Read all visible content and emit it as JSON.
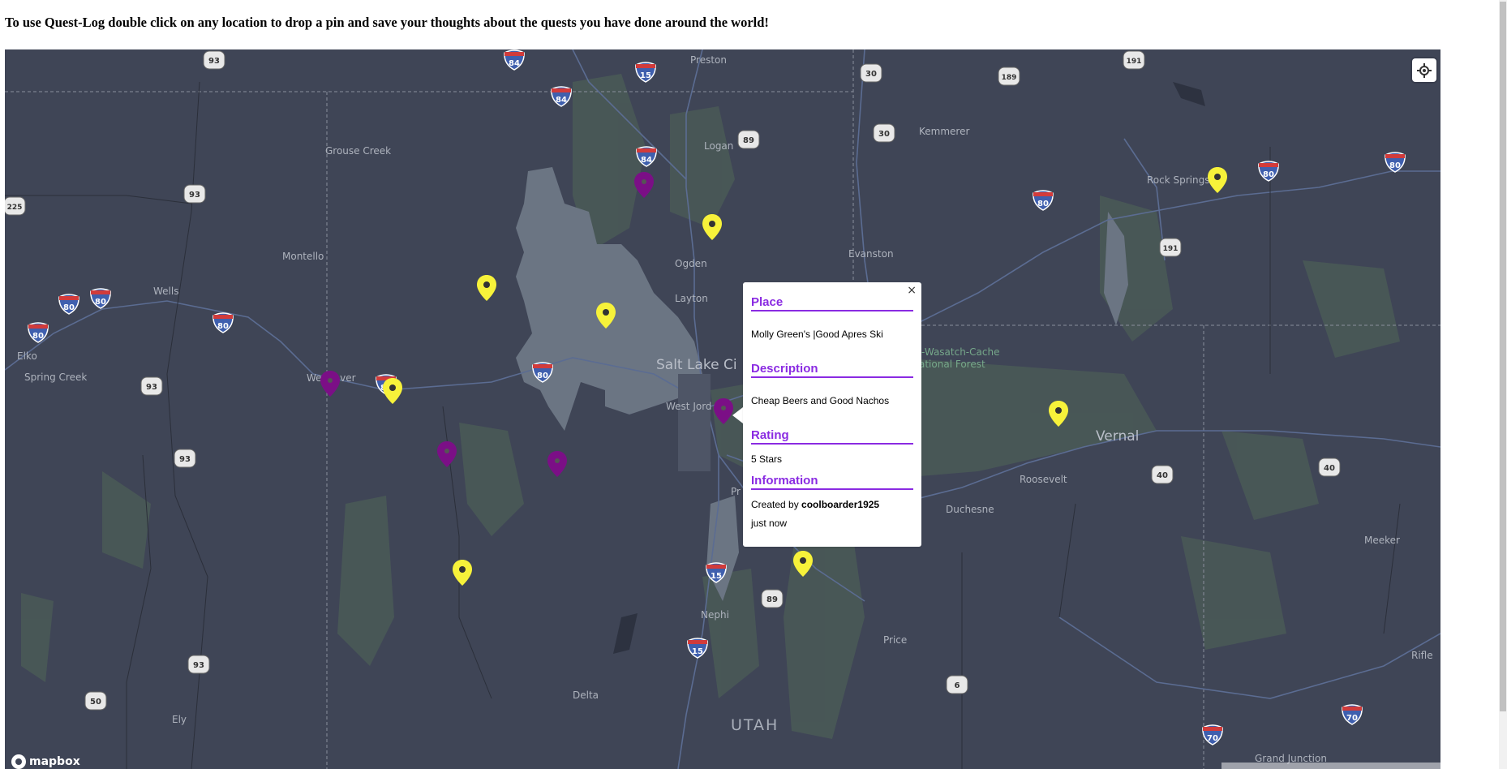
{
  "instructions": "To use Quest-Log double click on any location to drop a pin and save your thoughts about the quests you have done around the world!",
  "map": {
    "provider_logo": "mapbox",
    "colors": {
      "background": "#3f4556",
      "water": "#6b7583",
      "vegetation": "#4a5a56",
      "road": "#5b6c92",
      "yellow_pin": "#f7f23a",
      "purple_pin": "#7b0f86"
    },
    "labels": {
      "preston": "Preston",
      "logan": "Logan",
      "grouse_creek": "Grouse Creek",
      "montello": "Montello",
      "wells": "Wells",
      "elko": "Elko",
      "spring_creek": "Spring Creek",
      "ogden": "Ogden",
      "layton": "Layton",
      "slc": "Salt Lake Ci",
      "west_jordan": "West Jord",
      "wendover": "Wendover",
      "kemmerer": "Kemmerer",
      "rock_springs": "Rock Springs",
      "evanston": "Evanston",
      "forest": "-Wasatch-Cache",
      "forest2": "ational Forest",
      "vernal": "Vernal",
      "roosevelt": "Roosevelt",
      "duchesne": "Duchesne",
      "price": "Price",
      "nephi": "Nephi",
      "delta": "Delta",
      "ely": "Ely",
      "utah": "UTAH",
      "meeker": "Meeker",
      "rifle": "Rifle",
      "grand_junction": "Grand Junction",
      "provo": "Pr"
    },
    "shields": {
      "i84a": "84",
      "i84b": "84",
      "i84c": "84",
      "i15a": "15",
      "i15b": "15",
      "i15c": "15",
      "i80a": "80",
      "i80b": "80",
      "i80c": "80",
      "i80d": "80",
      "i80e": "80",
      "i80f": "80",
      "i80g": "80",
      "i80h": "80",
      "i80i": "80",
      "i70": "70",
      "us93a": "93",
      "us93b": "93",
      "us93c": "93",
      "us93d": "93",
      "us93e": "93",
      "us30a": "30",
      "us30b": "30",
      "us89a": "89",
      "us89b": "89",
      "us189": "189",
      "us191a": "191",
      "us191b": "191",
      "us40a": "40",
      "us40b": "40",
      "us6": "6",
      "us50": "50",
      "us225": "225",
      "i80w": "80"
    }
  },
  "popup": {
    "close_label": "×",
    "place_heading": "Place",
    "place_value": "Molly Green's |Good Apres Ski",
    "description_heading": "Description",
    "description_value": "Cheap Beers and Good Nachos",
    "rating_heading": "Rating",
    "rating_value": "5 Stars",
    "information_heading": "Information",
    "created_by_prefix": "Created by",
    "created_by_user": "coolboarder1925",
    "time": "just now"
  }
}
